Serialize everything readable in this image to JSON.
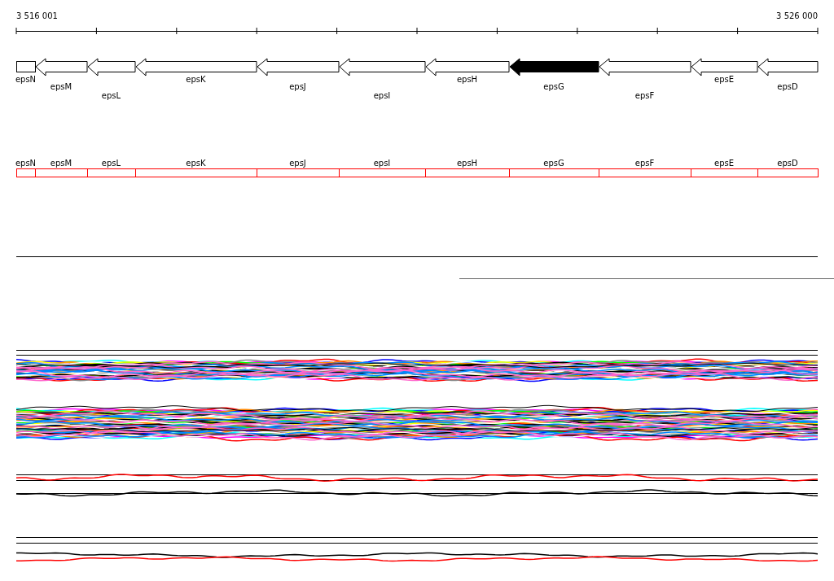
{
  "ruler": {
    "start_label": "3 516 001",
    "end_label": "3 526 000"
  },
  "genes": [
    {
      "name": "epsN",
      "kind": "box",
      "selected": false
    },
    {
      "name": "epsM",
      "kind": "arrow",
      "selected": false
    },
    {
      "name": "epsL",
      "kind": "arrow",
      "selected": false
    },
    {
      "name": "epsK",
      "kind": "arrow",
      "selected": false
    },
    {
      "name": "epsJ",
      "kind": "arrow",
      "selected": false
    },
    {
      "name": "epsI",
      "kind": "arrow",
      "selected": false
    },
    {
      "name": "epsH",
      "kind": "arrow",
      "selected": false
    },
    {
      "name": "epsG",
      "kind": "arrow",
      "selected": true
    },
    {
      "name": "epsF",
      "kind": "arrow",
      "selected": false
    },
    {
      "name": "epsE",
      "kind": "arrow",
      "selected": false
    },
    {
      "name": "epsD",
      "kind": "arrow",
      "selected": false
    }
  ],
  "features": [
    {
      "name": "epsN"
    },
    {
      "name": "epsM"
    },
    {
      "name": "epsL"
    },
    {
      "name": "epsK"
    },
    {
      "name": "epsJ"
    },
    {
      "name": "epsI"
    },
    {
      "name": "epsH"
    },
    {
      "name": "epsG"
    },
    {
      "name": "epsF"
    },
    {
      "name": "epsE"
    },
    {
      "name": "epsD"
    }
  ]
}
